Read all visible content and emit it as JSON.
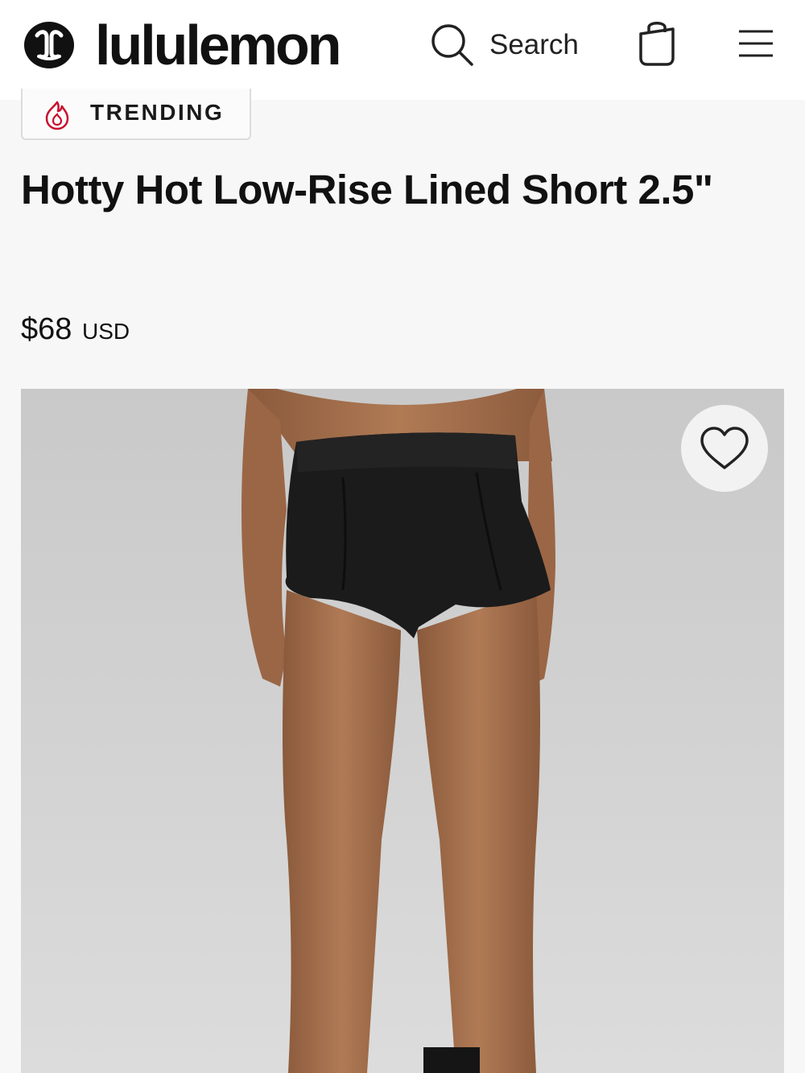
{
  "header": {
    "brand": "lululemon",
    "logo_icon": "lululemon-logo-icon",
    "search_label": "Search",
    "icons": [
      "search-icon",
      "shopping-bag-icon",
      "hamburger-menu-icon"
    ]
  },
  "product": {
    "badge": {
      "label": "TRENDING",
      "icon": "flame-icon",
      "icon_color": "#c8102e"
    },
    "title": "Hotty Hot Low-Rise Lined Short 2.5\"",
    "price": "$68",
    "currency": "USD",
    "image": {
      "favorite_icon": "heart-outline-icon"
    }
  },
  "colors": {
    "header_bg": "#ffffff",
    "page_bg": "#f7f7f7",
    "text": "#111111",
    "accent": "#c8102e"
  }
}
